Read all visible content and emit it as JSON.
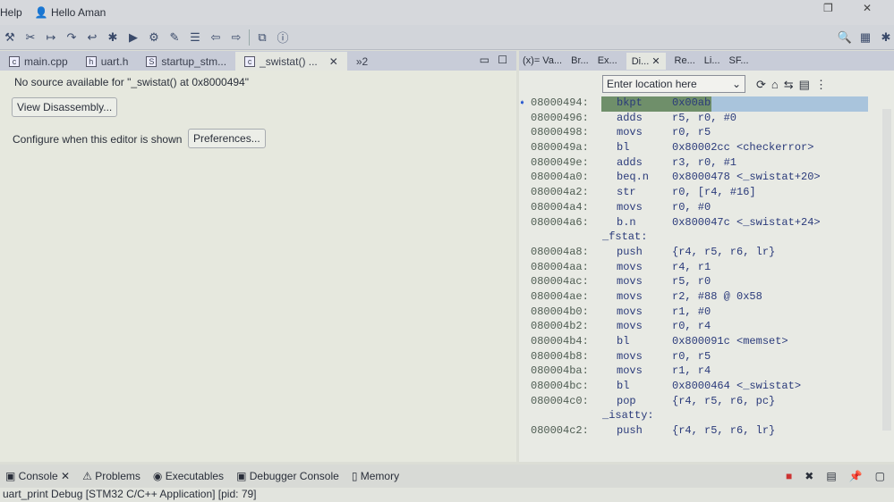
{
  "menubar": {
    "help": "Help",
    "user": "Hello Aman"
  },
  "editor": {
    "tabs": [
      {
        "label": "main.cpp",
        "icon": "c"
      },
      {
        "label": "uart.h",
        "icon": "h"
      },
      {
        "label": "startup_stm...",
        "icon": "S"
      },
      {
        "label": "_swistat() ...",
        "icon": "c",
        "active": true
      }
    ],
    "overflow": "»2",
    "message": "No source available for \"_swistat() at 0x8000494\"",
    "view_disassembly": "View Disassembly...",
    "configure_label": "Configure when this editor is shown",
    "preferences": "Preferences..."
  },
  "right_panel": {
    "tabs": [
      "(x)= Va...",
      "Br...",
      "Ex...",
      "Di...",
      "Re...",
      "Li...",
      "SF..."
    ],
    "location_placeholder": "Enter location here",
    "rows": [
      {
        "addr": "08000494:",
        "mn": "bkpt",
        "op": "0x00ab",
        "current": true
      },
      {
        "addr": "08000496:",
        "mn": "adds",
        "op": "r5, r0, #0"
      },
      {
        "addr": "08000498:",
        "mn": "movs",
        "op": "r0, r5"
      },
      {
        "addr": "0800049a:",
        "mn": "bl",
        "op": "0x80002cc <checkerror>"
      },
      {
        "addr": "0800049e:",
        "mn": "adds",
        "op": "r3, r0, #1"
      },
      {
        "addr": "080004a0:",
        "mn": "beq.n",
        "op": "0x8000478 <_swistat+20>"
      },
      {
        "addr": "080004a2:",
        "mn": "str",
        "op": "r0, [r4, #16]"
      },
      {
        "addr": "080004a4:",
        "mn": "movs",
        "op": "r0, #0"
      },
      {
        "addr": "080004a6:",
        "mn": "b.n",
        "op": "0x800047c <_swistat+24>"
      },
      {
        "label": "_fstat:"
      },
      {
        "addr": "080004a8:",
        "mn": "push",
        "op": "{r4, r5, r6, lr}"
      },
      {
        "addr": "080004aa:",
        "mn": "movs",
        "op": "r4, r1"
      },
      {
        "addr": "080004ac:",
        "mn": "movs",
        "op": "r5, r0"
      },
      {
        "addr": "080004ae:",
        "mn": "movs",
        "op": "r2, #88 @ 0x58"
      },
      {
        "addr": "080004b0:",
        "mn": "movs",
        "op": "r1, #0"
      },
      {
        "addr": "080004b2:",
        "mn": "movs",
        "op": "r0, r4"
      },
      {
        "addr": "080004b4:",
        "mn": "bl",
        "op": "0x800091c <memset>"
      },
      {
        "addr": "080004b8:",
        "mn": "movs",
        "op": "r0, r5"
      },
      {
        "addr": "080004ba:",
        "mn": "movs",
        "op": "r1, r4"
      },
      {
        "addr": "080004bc:",
        "mn": "bl",
        "op": "0x8000464 <_swistat>"
      },
      {
        "addr": "080004c0:",
        "mn": "pop",
        "op": "{r4, r5, r6, pc}"
      },
      {
        "label": "_isatty:"
      },
      {
        "addr": "080004c2:",
        "mn": "push",
        "op": "{r4, r5, r6, lr}"
      }
    ]
  },
  "bottom": {
    "tabs": [
      "Console",
      "Problems",
      "Executables",
      "Debugger Console",
      "Memory"
    ]
  },
  "status": "uart_print Debug [STM32 C/C++ Application]  [pid: 79]"
}
